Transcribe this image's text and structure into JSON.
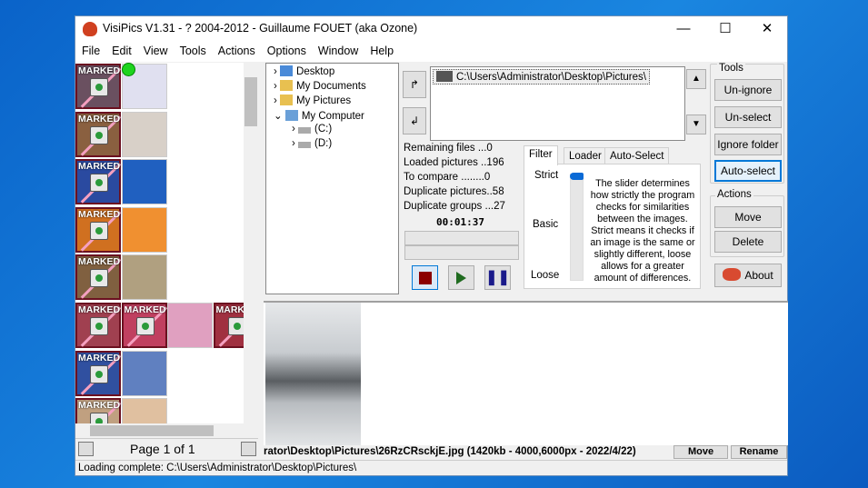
{
  "window": {
    "title": "VisiPics V1.31 - ? 2004-2012 - Guillaume FOUET (aka Ozone)",
    "minimize": "—",
    "maximize": "☐",
    "close": "✕"
  },
  "menu": [
    "File",
    "Edit",
    "View",
    "Tools",
    "Actions",
    "Options",
    "Window",
    "Help"
  ],
  "thumbs": {
    "marked_label": "MARKED",
    "page_label": "Page 1 of 1"
  },
  "tree": {
    "items": [
      "Desktop",
      "My Documents",
      "My Pictures",
      "My Computer",
      "(C:)",
      "(D:)"
    ]
  },
  "folders": {
    "path": "C:\\Users\\Administrator\\Desktop\\Pictures\\"
  },
  "stats": {
    "remaining": "Remaining files ...0",
    "loaded": "Loaded pictures ..196",
    "to_compare": "To compare ........0",
    "dup_pictures": "Duplicate pictures..58",
    "dup_groups": "Duplicate groups ...27",
    "timer": "00:01:37"
  },
  "tabs": {
    "filter": "Filter",
    "loader": "Loader",
    "autoselect": "Auto-Select"
  },
  "filter": {
    "strict": "Strict",
    "basic": "Basic",
    "loose": "Loose",
    "slider_level": "Strict",
    "description": "The slider determines how strictly the program checks for similarities between the images. Strict means it checks if an image is the same or slightly different, loose allows for a greater amount of differences."
  },
  "tools": {
    "title": "Tools",
    "unignore": "Un-ignore",
    "unselect": "Un-select",
    "ignore_folder": "Ignore folder",
    "autoselect": "Auto-select"
  },
  "actions": {
    "title": "Actions",
    "move": "Move",
    "delete": "Delete",
    "about": "About"
  },
  "preview": {
    "filename": "rator\\Desktop\\Pictures\\26RzCRsckjE.jpg (1420kb - 4000,6000px - 2022/4/22)",
    "move": "Move",
    "rename": "Rename"
  },
  "status": "Loading complete: C:\\Users\\Administrator\\Desktop\\Pictures\\"
}
